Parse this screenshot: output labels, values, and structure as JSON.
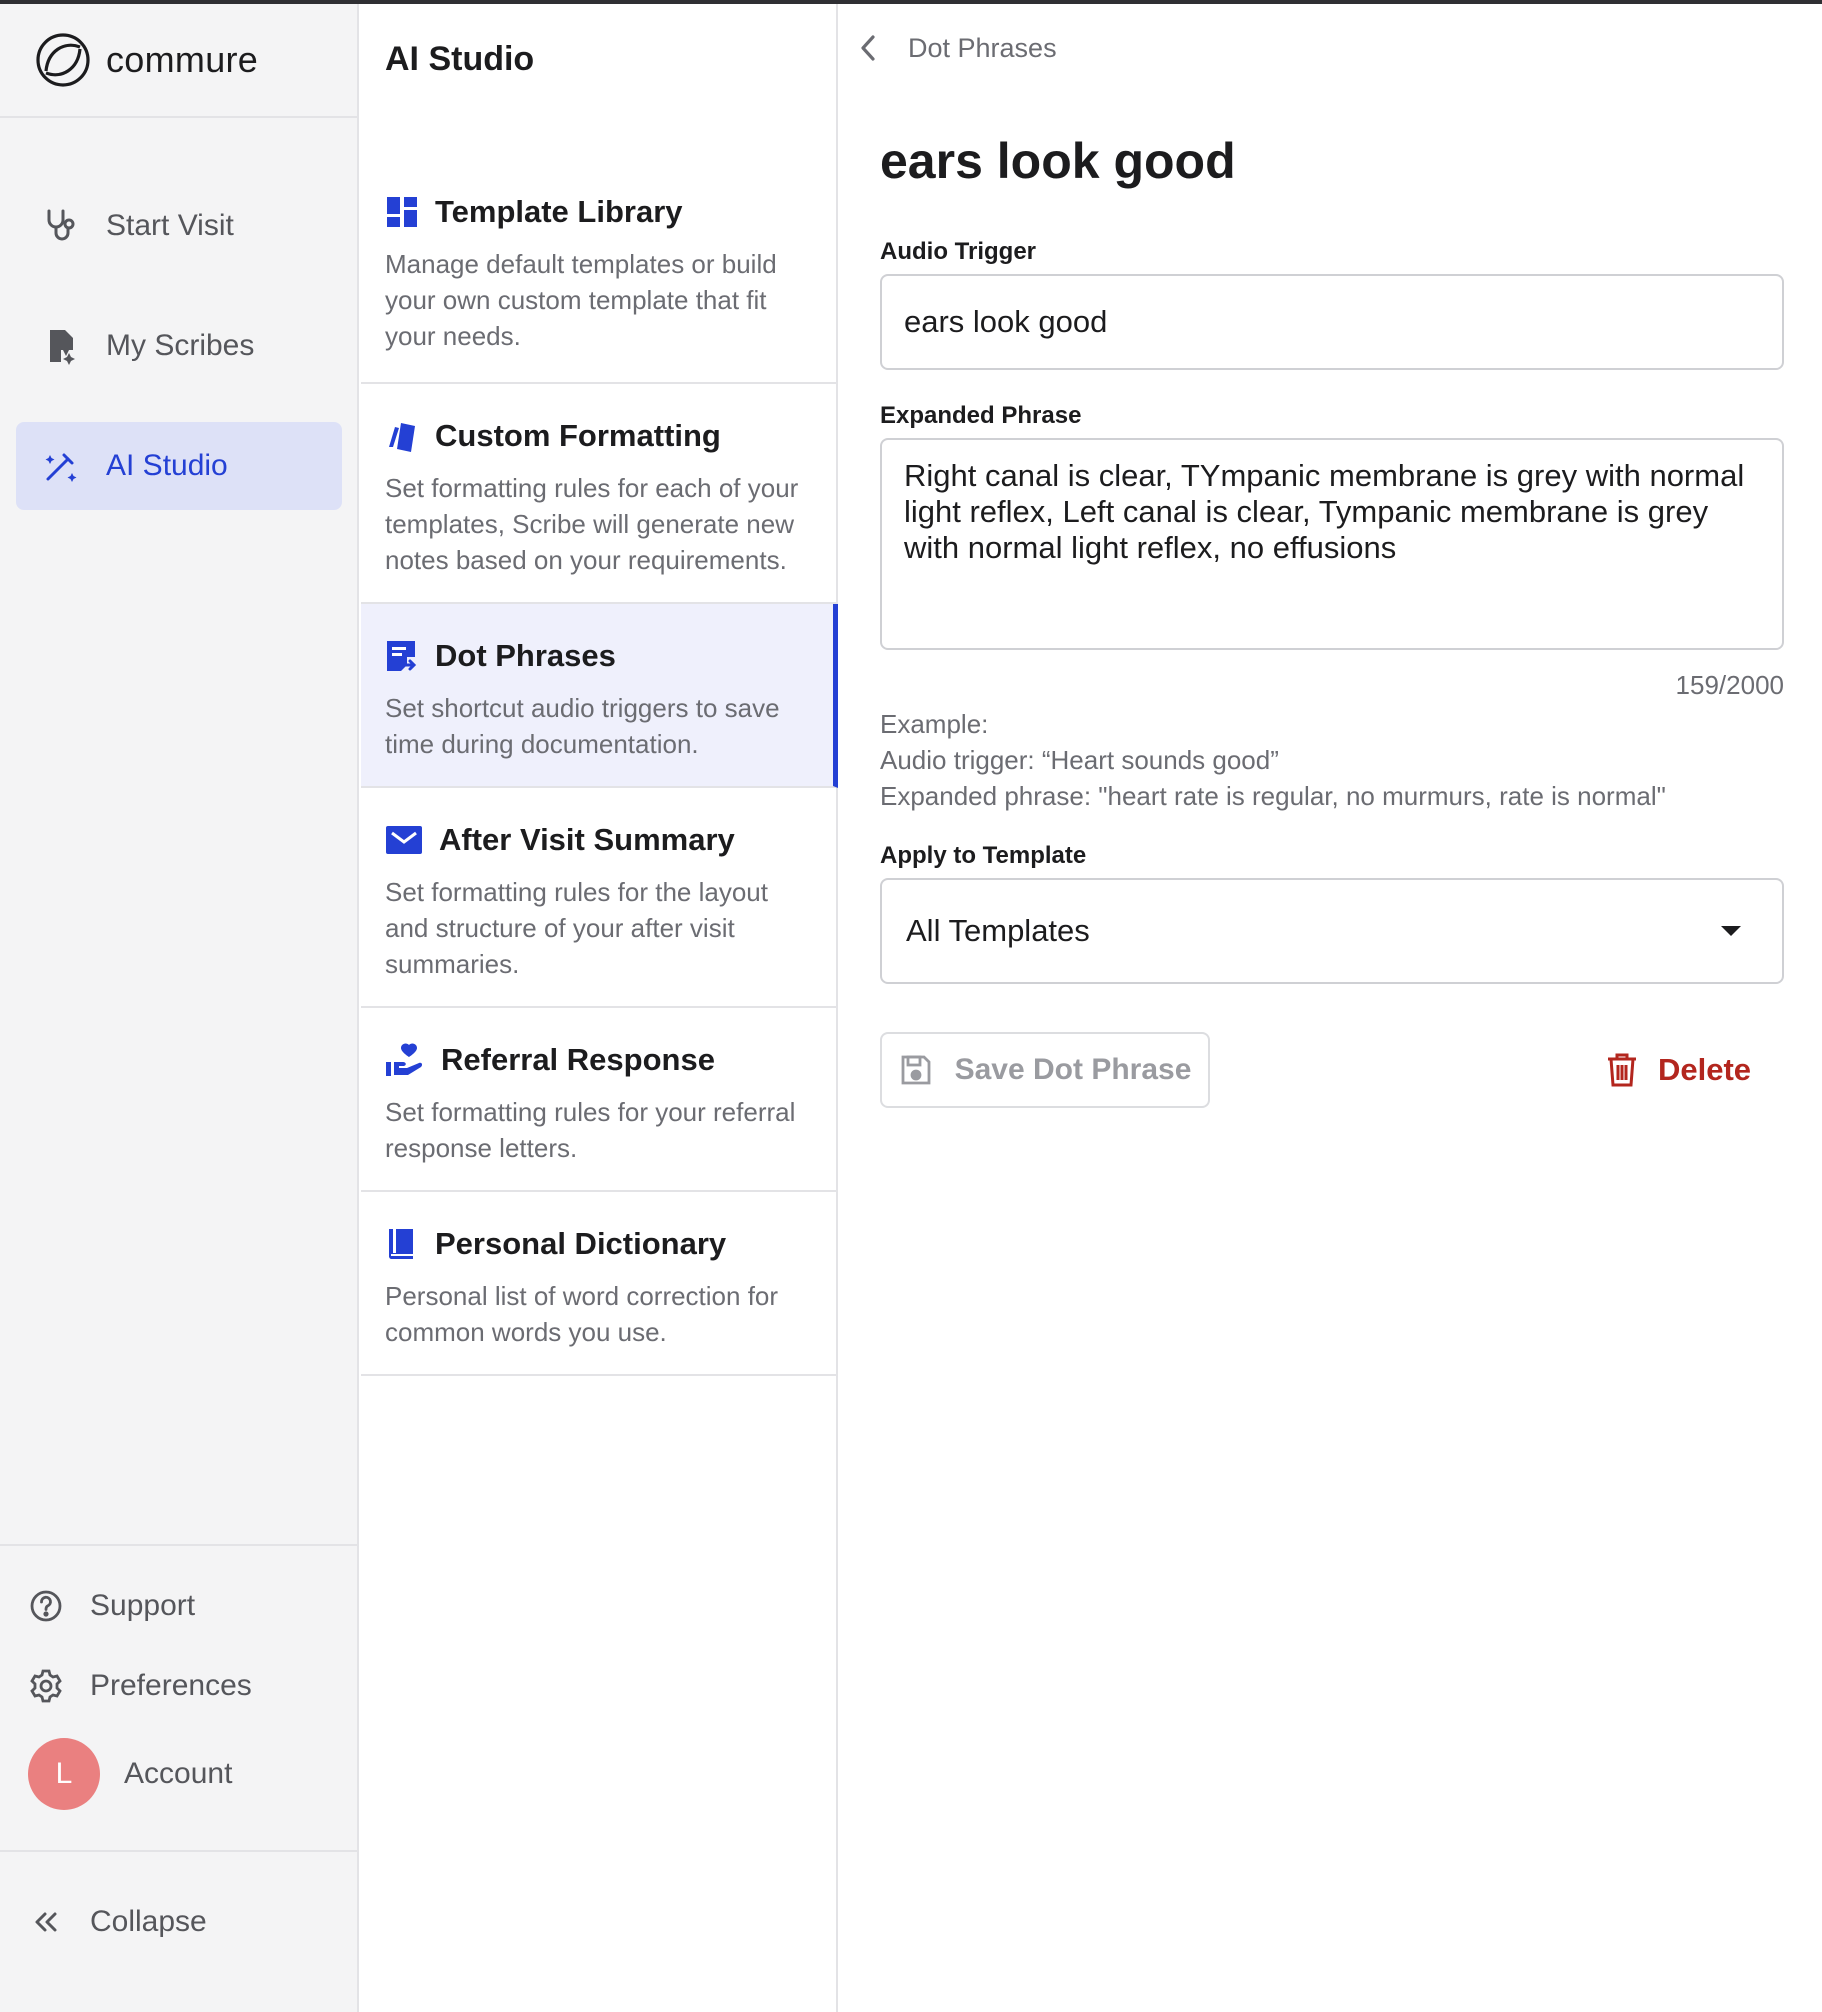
{
  "app": {
    "logo_text": "commure"
  },
  "sidebar": {
    "nav": [
      {
        "label": "Start Visit",
        "icon": "stethoscope-icon"
      },
      {
        "label": "My Scribes",
        "icon": "document-sparkle-icon"
      },
      {
        "label": "AI Studio",
        "icon": "magic-pen-icon",
        "active": true
      }
    ],
    "bottom": {
      "support": "Support",
      "preferences": "Preferences",
      "account": "Account",
      "avatar_initial": "L",
      "collapse": "Collapse"
    }
  },
  "studio": {
    "title": "AI Studio",
    "items": [
      {
        "title": "Template Library",
        "desc": "Manage default templates or build your own custom template that fit your needs.",
        "icon": "dashboard-grid-icon"
      },
      {
        "title": "Custom Formatting",
        "desc": "Set formatting rules for each of your templates, Scribe will generate new notes based on your requirements.",
        "icon": "swatch-icon"
      },
      {
        "title": "Dot Phrases",
        "desc": "Set shortcut audio triggers to save time during documentation.",
        "icon": "note-arrow-icon",
        "active": true
      },
      {
        "title": "After Visit Summary",
        "desc": "Set formatting rules for the layout and structure of your after visit summaries.",
        "icon": "mail-icon"
      },
      {
        "title": "Referral Response",
        "desc": "Set formatting rules for your referral response letters.",
        "icon": "hand-heart-icon"
      },
      {
        "title": "Personal Dictionary",
        "desc": "Personal list of word correction for common words you use.",
        "icon": "book-icon"
      }
    ]
  },
  "detail": {
    "breadcrumb": "Dot Phrases",
    "title": "ears look good",
    "audio_trigger_label": "Audio Trigger",
    "audio_trigger_value": "ears look good",
    "expanded_label": "Expanded Phrase",
    "expanded_value": "Right canal is clear, TYmpanic membrane is grey with normal light reflex, Left canal is clear, Tympanic membrane is grey with normal light reflex, no effusions",
    "counter": "159/2000",
    "example_heading": "Example:",
    "example_trigger": "Audio trigger: “Heart sounds good”",
    "example_phrase": "Expanded phrase: \"heart rate is regular, no murmurs, rate is normal\"",
    "apply_label": "Apply to Template",
    "apply_value": "All Templates",
    "save_label": "Save Dot Phrase",
    "delete_label": "Delete"
  },
  "colors": {
    "accent": "#2440d4",
    "active_nav_bg": "#dde1f7",
    "active_card_bg": "#eff0fc",
    "danger": "#b3261e",
    "avatar": "#ea8080"
  }
}
